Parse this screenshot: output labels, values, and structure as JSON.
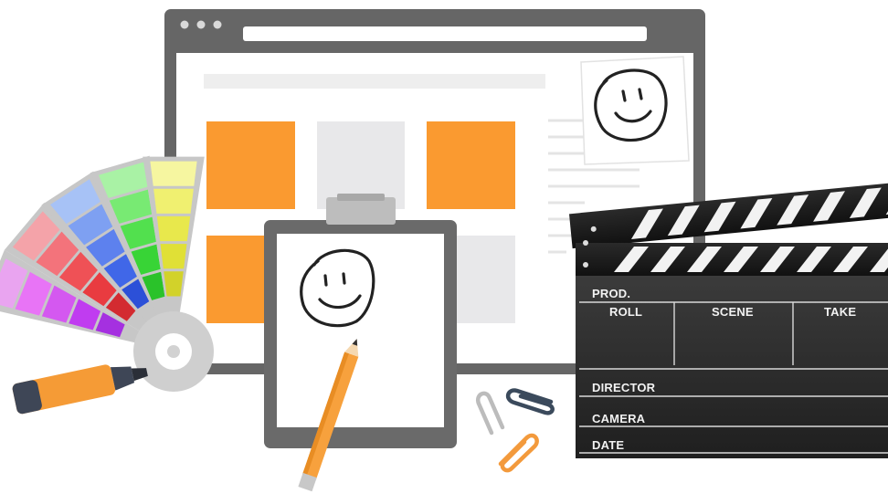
{
  "illustration": {
    "browser": {
      "dots": [
        "dot-1",
        "dot-2",
        "dot-3"
      ],
      "colors": {
        "frame": "#666666",
        "orange": "#fa9a30",
        "gray_tile": "#e7e7e9",
        "text_lines": "#e6e6e6"
      }
    },
    "color_swatch": {
      "columns": [
        [
          "#e9a4f0",
          "#e874f6",
          "#d458f0",
          "#c03cf0",
          "#a530e0"
        ],
        [
          "#f4a3a9",
          "#f3737b",
          "#ef5156",
          "#e93b40",
          "#d32b30"
        ],
        [
          "#a7c2f6",
          "#7ea0f2",
          "#5d81ee",
          "#4067e8",
          "#2c50d8"
        ],
        [
          "#a9f2a5",
          "#78ea73",
          "#52e04e",
          "#38d436",
          "#2ac22a"
        ],
        [
          "#f6f6a0",
          "#f0f070",
          "#e8e84c",
          "#e0e036",
          "#d2d22a"
        ]
      ]
    },
    "clapperboard": {
      "labels": {
        "prod": "PROD.",
        "roll": "ROLL",
        "scene": "SCENE",
        "take": "TAKE",
        "director": "DIRECTOR",
        "camera": "CAMERA",
        "date": "DATE"
      }
    },
    "icons": [
      "smiley-face-icon",
      "pencil-icon",
      "highlighter-icon",
      "paper-clip-icon",
      "clipboard-icon"
    ]
  }
}
